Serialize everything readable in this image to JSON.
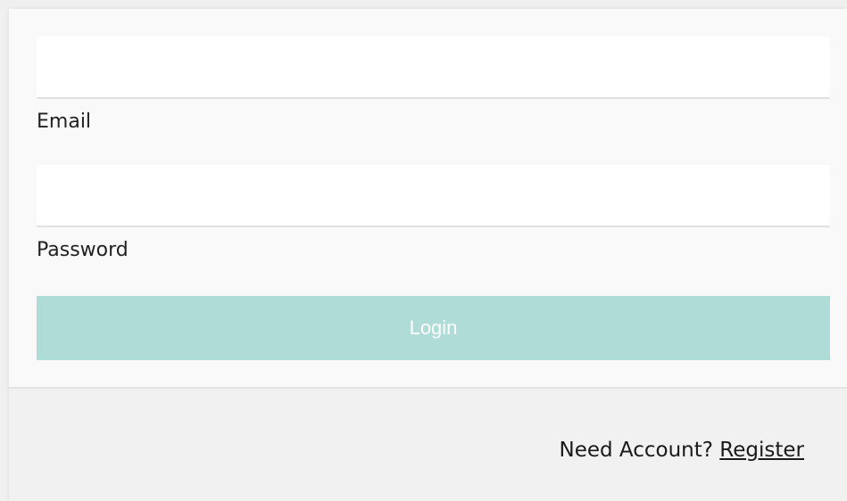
{
  "form": {
    "email": {
      "label": "Email",
      "value": "",
      "placeholder": ""
    },
    "password": {
      "label": "Password",
      "value": "",
      "placeholder": ""
    },
    "login_label": "Login",
    "login_button_color": "#afdcd7"
  },
  "footer": {
    "prompt": "Need Account?",
    "register_label": "Register"
  }
}
